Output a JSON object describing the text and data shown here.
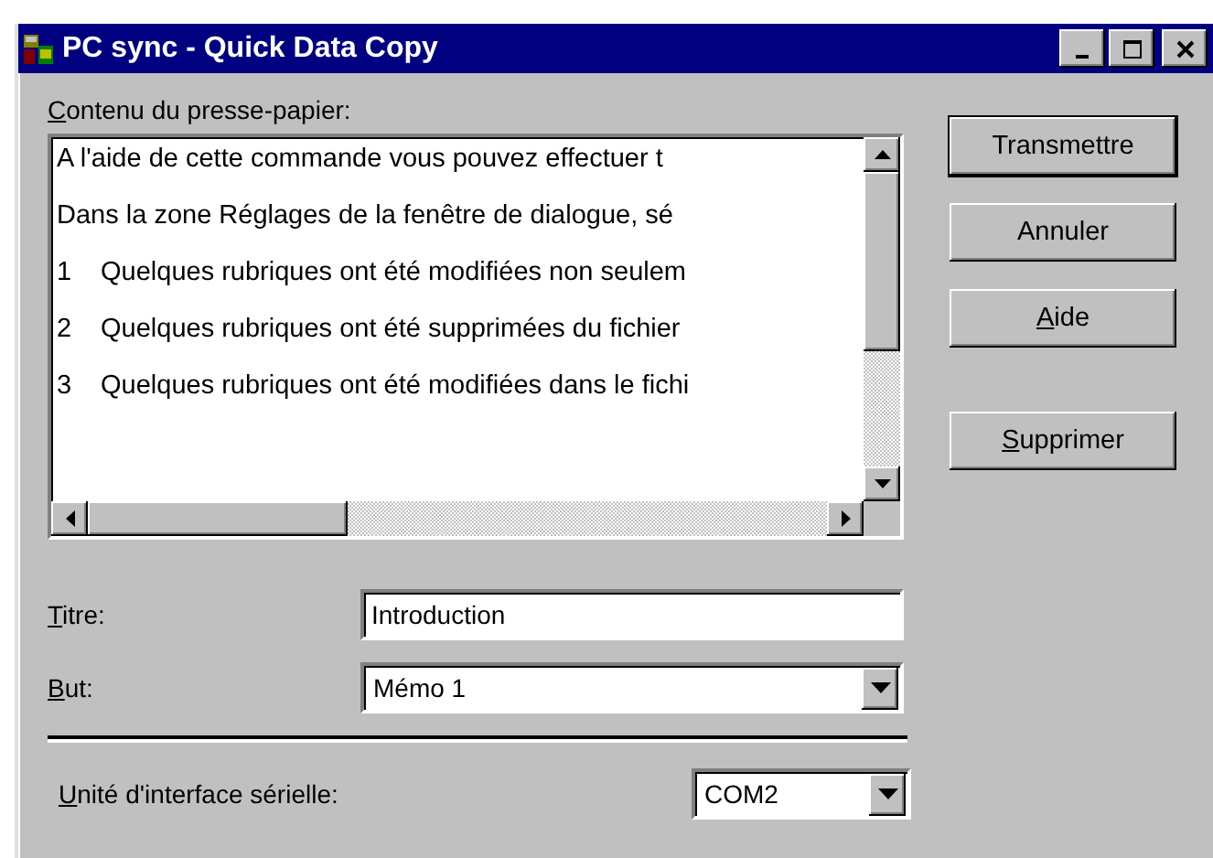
{
  "window": {
    "title": "PC sync - Quick Data Copy"
  },
  "clipboard": {
    "label": {
      "access": "C",
      "rest": "ontenu du presse-papier:"
    },
    "lines": [
      {
        "kind": "text",
        "text": "A l'aide de cette commande vous pouvez effectuer t"
      },
      {
        "kind": "text",
        "text": "Dans la zone Réglages de la fenêtre de dialogue, sé"
      },
      {
        "kind": "numbered",
        "number": "1",
        "text": "Quelques rubriques ont été modifiées non seulem"
      },
      {
        "kind": "numbered",
        "number": "2",
        "text": "Quelques rubriques ont été supprimées du fichier"
      },
      {
        "kind": "numbered",
        "number": "3",
        "text": "Quelques rubriques ont été modifiées dans le fichi"
      }
    ]
  },
  "buttons": [
    {
      "label": {
        "rest": "Transmettre"
      },
      "default": true
    },
    {
      "label": {
        "rest": "Annuler"
      },
      "default": false
    },
    {
      "label": {
        "access": "A",
        "rest": "ide"
      },
      "default": false
    },
    {
      "label": {
        "access": "S",
        "rest": "upprimer"
      },
      "default": false
    }
  ],
  "title_field": {
    "label": {
      "access": "T",
      "rest": "itre:"
    },
    "value": "Introduction"
  },
  "purpose_field": {
    "label": {
      "access": "B",
      "rest": "ut:"
    },
    "value": "Mémo 1"
  },
  "port_field": {
    "label": {
      "access": "U",
      "rest": "nité d'interface sérielle:"
    },
    "value": "COM2"
  }
}
